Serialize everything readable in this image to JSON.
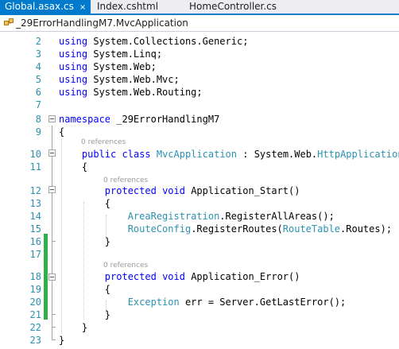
{
  "tabs": [
    {
      "label": "Global.asax.cs",
      "active": true,
      "close_glyph": "×"
    },
    {
      "label": "Index.cshtml",
      "active": false
    },
    {
      "label": "HomeController.cs",
      "active": false
    }
  ],
  "navbar": {
    "icon": "csharp-class-icon",
    "class_path": "_29ErrorHandlingM7.MvcApplication"
  },
  "codelens": {
    "label": "0 references"
  },
  "lines": [
    {
      "n": "2",
      "parts": [
        {
          "k": "kw",
          "t": "using"
        },
        {
          "k": "",
          "t": " System.Collections.Generic;"
        }
      ]
    },
    {
      "n": "3",
      "parts": [
        {
          "k": "kw",
          "t": "using"
        },
        {
          "k": "",
          "t": " System.Linq;"
        }
      ]
    },
    {
      "n": "4",
      "parts": [
        {
          "k": "kw",
          "t": "using"
        },
        {
          "k": "",
          "t": " System.Web;"
        }
      ]
    },
    {
      "n": "5",
      "parts": [
        {
          "k": "kw",
          "t": "using"
        },
        {
          "k": "",
          "t": " System.Web.Mvc;"
        }
      ]
    },
    {
      "n": "6",
      "parts": [
        {
          "k": "kw",
          "t": "using"
        },
        {
          "k": "",
          "t": " System.Web.Routing;"
        }
      ]
    },
    {
      "n": "7",
      "parts": []
    },
    {
      "n": "8",
      "parts": [
        {
          "k": "kw",
          "t": "namespace"
        },
        {
          "k": "",
          "t": " _29ErrorHandlingM7"
        }
      ]
    },
    {
      "n": "9",
      "parts": [
        {
          "k": "",
          "t": "{"
        }
      ]
    },
    {
      "n": "10",
      "parts": [
        {
          "k": "",
          "t": "    "
        },
        {
          "k": "kw",
          "t": "public"
        },
        {
          "k": "",
          "t": " "
        },
        {
          "k": "kw",
          "t": "class"
        },
        {
          "k": "",
          "t": " "
        },
        {
          "k": "ty",
          "t": "MvcApplication"
        },
        {
          "k": "",
          "t": " : System.Web."
        },
        {
          "k": "ty",
          "t": "HttpApplication"
        }
      ]
    },
    {
      "n": "11",
      "parts": [
        {
          "k": "",
          "t": "    {"
        }
      ]
    },
    {
      "n": "12",
      "parts": [
        {
          "k": "",
          "t": "        "
        },
        {
          "k": "kw",
          "t": "protected"
        },
        {
          "k": "",
          "t": " "
        },
        {
          "k": "kw",
          "t": "void"
        },
        {
          "k": "",
          "t": " Application_Start()"
        }
      ]
    },
    {
      "n": "13",
      "parts": [
        {
          "k": "",
          "t": "        {"
        }
      ]
    },
    {
      "n": "14",
      "parts": [
        {
          "k": "",
          "t": "            "
        },
        {
          "k": "ty",
          "t": "AreaRegistration"
        },
        {
          "k": "",
          "t": ".RegisterAllAreas();"
        }
      ]
    },
    {
      "n": "15",
      "parts": [
        {
          "k": "",
          "t": "            "
        },
        {
          "k": "ty",
          "t": "RouteConfig"
        },
        {
          "k": "",
          "t": ".RegisterRoutes("
        },
        {
          "k": "ty",
          "t": "RouteTable"
        },
        {
          "k": "",
          "t": ".Routes);"
        }
      ]
    },
    {
      "n": "16",
      "parts": [
        {
          "k": "",
          "t": "        }"
        }
      ]
    },
    {
      "n": "17",
      "parts": []
    },
    {
      "n": "18",
      "parts": [
        {
          "k": "",
          "t": "        "
        },
        {
          "k": "kw",
          "t": "protected"
        },
        {
          "k": "",
          "t": " "
        },
        {
          "k": "kw",
          "t": "void"
        },
        {
          "k": "",
          "t": " Application_Error()"
        }
      ]
    },
    {
      "n": "19",
      "parts": [
        {
          "k": "",
          "t": "        {"
        }
      ]
    },
    {
      "n": "20",
      "parts": [
        {
          "k": "",
          "t": "            "
        },
        {
          "k": "ty",
          "t": "Exception"
        },
        {
          "k": "",
          "t": " err = Server.GetLastError();"
        }
      ]
    },
    {
      "n": "21",
      "parts": [
        {
          "k": "",
          "t": "        }"
        }
      ]
    },
    {
      "n": "22",
      "parts": [
        {
          "k": "",
          "t": "    }"
        }
      ]
    },
    {
      "n": "23",
      "parts": [
        {
          "k": "",
          "t": "}"
        }
      ]
    }
  ],
  "colors": {
    "keyword": "#0000ff",
    "type": "#2b91af",
    "line_number": "#2b91af",
    "active_tab": "#007acc",
    "changed_line_marker": "#2fb14a"
  }
}
